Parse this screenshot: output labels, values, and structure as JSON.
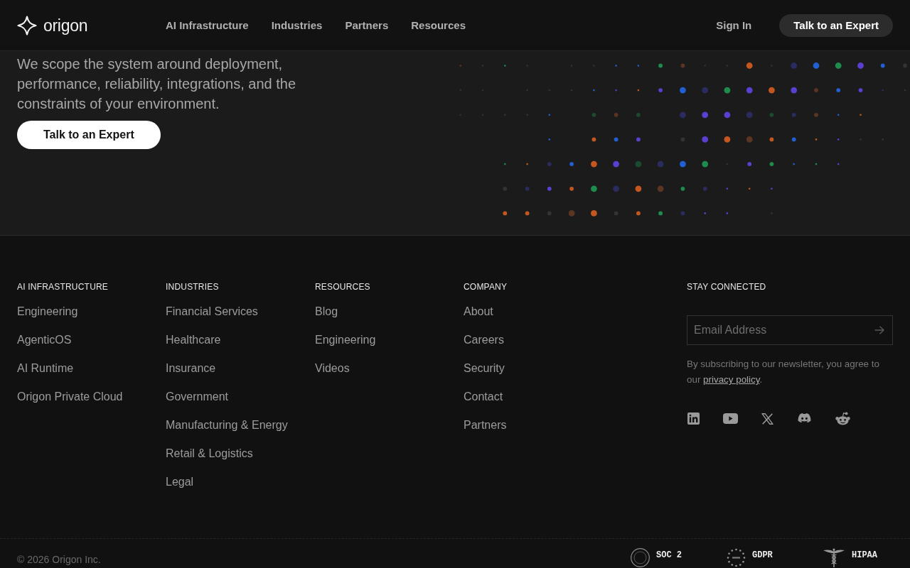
{
  "header": {
    "logo_text": "origon",
    "nav": [
      "AI Infrastructure",
      "Industries",
      "Partners",
      "Resources"
    ],
    "sign_in": "Sign In",
    "cta": "Talk to an Expert"
  },
  "hero": {
    "text": "We scope the system around deployment, performance, reliability, integrations, and the constraints of your environment.",
    "cta": "Talk to an Expert"
  },
  "footer": {
    "columns": [
      {
        "heading": "AI INFRASTRUCTURE",
        "links": [
          "Engineering",
          "AgenticOS",
          "AI Runtime",
          "Origon Private Cloud"
        ]
      },
      {
        "heading": "INDUSTRIES",
        "links": [
          "Financial Services",
          "Healthcare",
          "Insurance",
          "Government",
          "Manufacturing & Energy",
          "Retail & Logistics",
          "Legal"
        ]
      },
      {
        "heading": "RESOURCES",
        "links": [
          "Blog",
          "Engineering",
          "Videos"
        ]
      },
      {
        "heading": "COMPANY",
        "links": [
          "About",
          "Careers",
          "Security",
          "Contact",
          "Partners"
        ]
      }
    ],
    "newsletter": {
      "heading": "STAY CONNECTED",
      "placeholder": "Email Address",
      "note": "By subscribing to our newsletter, you agree to our",
      "link": "privacy policy",
      "note_end": "."
    },
    "copyright": "© 2026 Origon Inc.",
    "badges": [
      {
        "kind": "seal",
        "title": "SOC 2"
      },
      {
        "kind": "stars",
        "title": "GDPR"
      },
      {
        "kind": "caduceus",
        "title": "HIPAA"
      }
    ]
  }
}
